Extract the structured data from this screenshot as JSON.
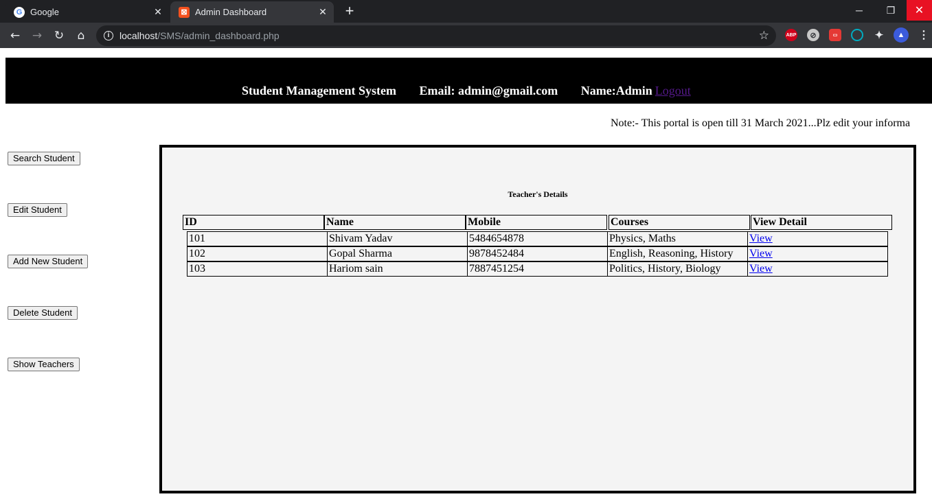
{
  "browser": {
    "tabs": [
      {
        "title": "Google",
        "favicon": "google-icon",
        "active": false
      },
      {
        "title": "Admin Dashboard",
        "favicon": "xampp-icon",
        "active": true
      }
    ],
    "url_host": "localhost",
    "url_path": "/SMS/admin_dashboard.php"
  },
  "header": {
    "site_title": "Student Management System",
    "email": "Email: admin@gmail.com",
    "name": "Name:Admin",
    "logout": "Logout"
  },
  "note": "Note:- This portal is open till 31 March 2021...Plz edit your informa",
  "sidebar": {
    "buttons": [
      {
        "label": "Search Student"
      },
      {
        "label": "Edit Student"
      },
      {
        "label": "Add New Student"
      },
      {
        "label": "Delete Student"
      },
      {
        "label": "Show Teachers"
      }
    ]
  },
  "main": {
    "title": "Teacher's Details",
    "columns": [
      "ID",
      "Name",
      "Mobile",
      "Courses",
      "View Detail"
    ],
    "rows": [
      {
        "id": "101",
        "name": "Shivam Yadav",
        "mobile": "5484654878",
        "courses": "Physics, Maths",
        "action": "View"
      },
      {
        "id": "102",
        "name": "Gopal Sharma",
        "mobile": "9878452484",
        "courses": "English, Reasoning, History",
        "action": "View"
      },
      {
        "id": "103",
        "name": "Hariom sain",
        "mobile": "7887451254",
        "courses": "Politics, History, Biology",
        "action": "View"
      }
    ]
  }
}
